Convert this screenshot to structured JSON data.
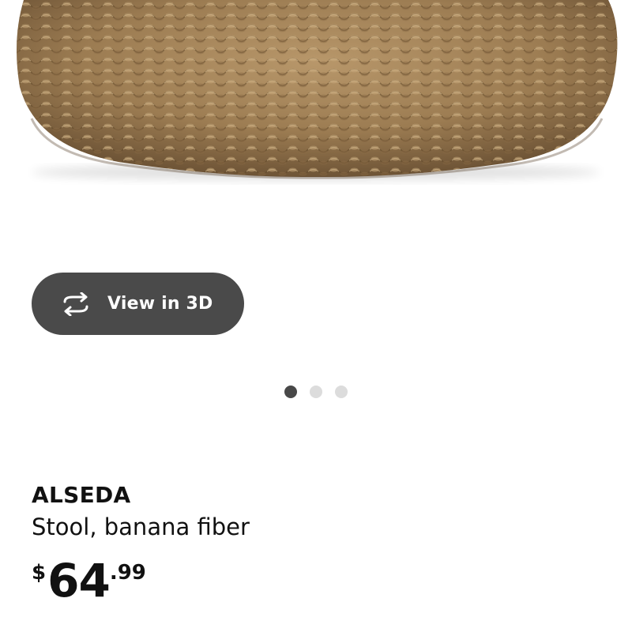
{
  "product": {
    "image_alt": "ALSEDA stool, woven banana fiber",
    "view_3d_label": "View in 3D",
    "view_3d_icon": "rotate-3d-icon",
    "carousel": {
      "count": 3,
      "active_index": 0
    },
    "name": "ALSEDA",
    "description": "Stool, banana fiber",
    "price": {
      "currency": "$",
      "whole": "64",
      "cents": ".99"
    }
  }
}
